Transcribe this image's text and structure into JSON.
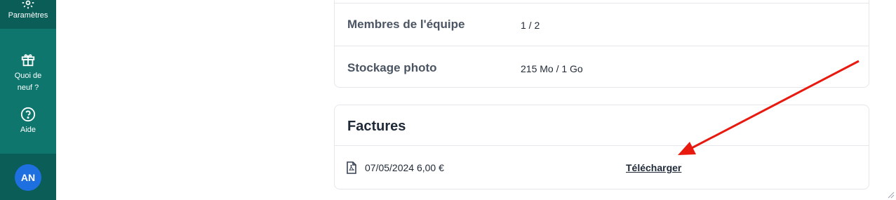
{
  "sidebar": {
    "items": [
      {
        "label": "Paramètres",
        "icon": "gear-icon"
      },
      {
        "label": "Quoi de neuf ?",
        "icon": "gift-icon"
      },
      {
        "label": "Aide",
        "icon": "help-circle-icon"
      }
    ],
    "avatar": {
      "initials": "AN",
      "color": "#1e6fe0"
    },
    "colors": {
      "background": "#0f766e",
      "active": "#0b5e58"
    }
  },
  "usage": {
    "rows": [
      {
        "label": "Membres de l'équipe",
        "value": "1 / 2"
      },
      {
        "label": "Stockage photo",
        "value": "215 Mo / 1 Go"
      }
    ]
  },
  "invoices": {
    "title": "Factures",
    "items": [
      {
        "icon": "pdf-file-icon",
        "text": "07/05/2024 6,00 €",
        "download_label": "Télécharger"
      }
    ]
  },
  "annotation": {
    "color": "#e8190f",
    "icon": "red-arrow"
  }
}
